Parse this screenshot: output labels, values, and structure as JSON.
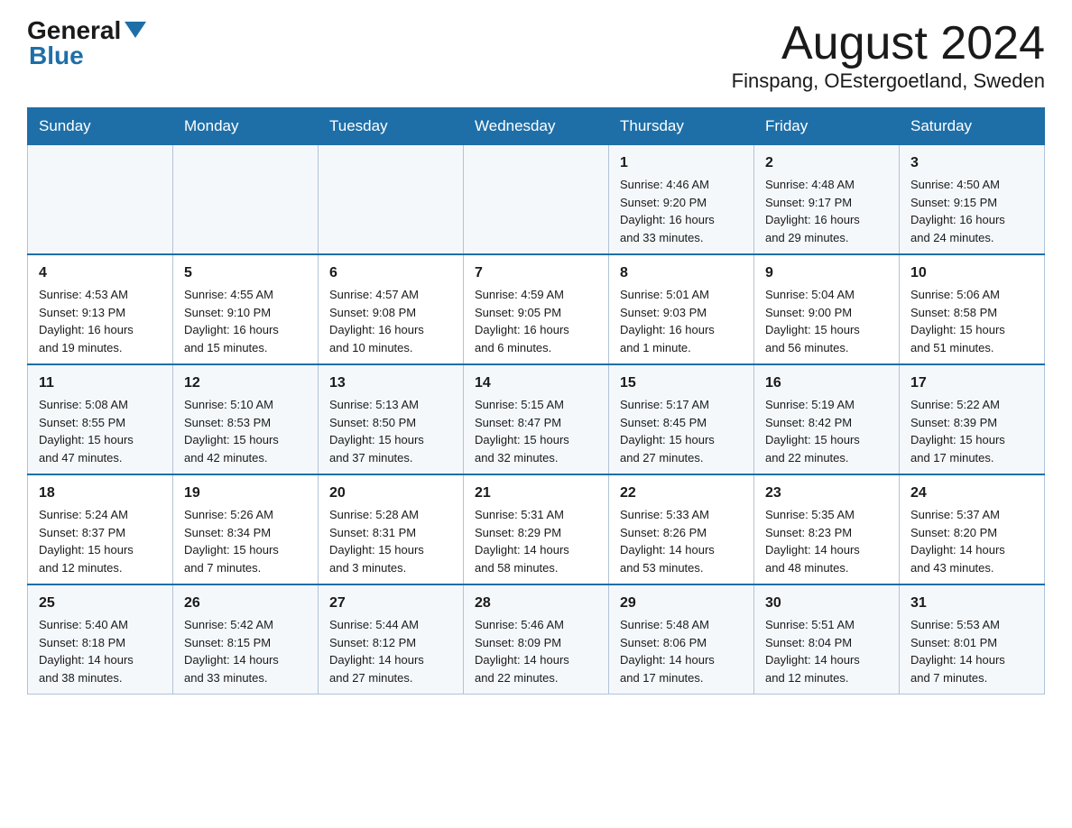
{
  "logo": {
    "general": "General",
    "blue": "Blue"
  },
  "header": {
    "month": "August 2024",
    "location": "Finspang, OEstergoetland, Sweden"
  },
  "weekdays": [
    "Sunday",
    "Monday",
    "Tuesday",
    "Wednesday",
    "Thursday",
    "Friday",
    "Saturday"
  ],
  "weeks": [
    [
      {
        "day": "",
        "info": ""
      },
      {
        "day": "",
        "info": ""
      },
      {
        "day": "",
        "info": ""
      },
      {
        "day": "",
        "info": ""
      },
      {
        "day": "1",
        "info": "Sunrise: 4:46 AM\nSunset: 9:20 PM\nDaylight: 16 hours\nand 33 minutes."
      },
      {
        "day": "2",
        "info": "Sunrise: 4:48 AM\nSunset: 9:17 PM\nDaylight: 16 hours\nand 29 minutes."
      },
      {
        "day": "3",
        "info": "Sunrise: 4:50 AM\nSunset: 9:15 PM\nDaylight: 16 hours\nand 24 minutes."
      }
    ],
    [
      {
        "day": "4",
        "info": "Sunrise: 4:53 AM\nSunset: 9:13 PM\nDaylight: 16 hours\nand 19 minutes."
      },
      {
        "day": "5",
        "info": "Sunrise: 4:55 AM\nSunset: 9:10 PM\nDaylight: 16 hours\nand 15 minutes."
      },
      {
        "day": "6",
        "info": "Sunrise: 4:57 AM\nSunset: 9:08 PM\nDaylight: 16 hours\nand 10 minutes."
      },
      {
        "day": "7",
        "info": "Sunrise: 4:59 AM\nSunset: 9:05 PM\nDaylight: 16 hours\nand 6 minutes."
      },
      {
        "day": "8",
        "info": "Sunrise: 5:01 AM\nSunset: 9:03 PM\nDaylight: 16 hours\nand 1 minute."
      },
      {
        "day": "9",
        "info": "Sunrise: 5:04 AM\nSunset: 9:00 PM\nDaylight: 15 hours\nand 56 minutes."
      },
      {
        "day": "10",
        "info": "Sunrise: 5:06 AM\nSunset: 8:58 PM\nDaylight: 15 hours\nand 51 minutes."
      }
    ],
    [
      {
        "day": "11",
        "info": "Sunrise: 5:08 AM\nSunset: 8:55 PM\nDaylight: 15 hours\nand 47 minutes."
      },
      {
        "day": "12",
        "info": "Sunrise: 5:10 AM\nSunset: 8:53 PM\nDaylight: 15 hours\nand 42 minutes."
      },
      {
        "day": "13",
        "info": "Sunrise: 5:13 AM\nSunset: 8:50 PM\nDaylight: 15 hours\nand 37 minutes."
      },
      {
        "day": "14",
        "info": "Sunrise: 5:15 AM\nSunset: 8:47 PM\nDaylight: 15 hours\nand 32 minutes."
      },
      {
        "day": "15",
        "info": "Sunrise: 5:17 AM\nSunset: 8:45 PM\nDaylight: 15 hours\nand 27 minutes."
      },
      {
        "day": "16",
        "info": "Sunrise: 5:19 AM\nSunset: 8:42 PM\nDaylight: 15 hours\nand 22 minutes."
      },
      {
        "day": "17",
        "info": "Sunrise: 5:22 AM\nSunset: 8:39 PM\nDaylight: 15 hours\nand 17 minutes."
      }
    ],
    [
      {
        "day": "18",
        "info": "Sunrise: 5:24 AM\nSunset: 8:37 PM\nDaylight: 15 hours\nand 12 minutes."
      },
      {
        "day": "19",
        "info": "Sunrise: 5:26 AM\nSunset: 8:34 PM\nDaylight: 15 hours\nand 7 minutes."
      },
      {
        "day": "20",
        "info": "Sunrise: 5:28 AM\nSunset: 8:31 PM\nDaylight: 15 hours\nand 3 minutes."
      },
      {
        "day": "21",
        "info": "Sunrise: 5:31 AM\nSunset: 8:29 PM\nDaylight: 14 hours\nand 58 minutes."
      },
      {
        "day": "22",
        "info": "Sunrise: 5:33 AM\nSunset: 8:26 PM\nDaylight: 14 hours\nand 53 minutes."
      },
      {
        "day": "23",
        "info": "Sunrise: 5:35 AM\nSunset: 8:23 PM\nDaylight: 14 hours\nand 48 minutes."
      },
      {
        "day": "24",
        "info": "Sunrise: 5:37 AM\nSunset: 8:20 PM\nDaylight: 14 hours\nand 43 minutes."
      }
    ],
    [
      {
        "day": "25",
        "info": "Sunrise: 5:40 AM\nSunset: 8:18 PM\nDaylight: 14 hours\nand 38 minutes."
      },
      {
        "day": "26",
        "info": "Sunrise: 5:42 AM\nSunset: 8:15 PM\nDaylight: 14 hours\nand 33 minutes."
      },
      {
        "day": "27",
        "info": "Sunrise: 5:44 AM\nSunset: 8:12 PM\nDaylight: 14 hours\nand 27 minutes."
      },
      {
        "day": "28",
        "info": "Sunrise: 5:46 AM\nSunset: 8:09 PM\nDaylight: 14 hours\nand 22 minutes."
      },
      {
        "day": "29",
        "info": "Sunrise: 5:48 AM\nSunset: 8:06 PM\nDaylight: 14 hours\nand 17 minutes."
      },
      {
        "day": "30",
        "info": "Sunrise: 5:51 AM\nSunset: 8:04 PM\nDaylight: 14 hours\nand 12 minutes."
      },
      {
        "day": "31",
        "info": "Sunrise: 5:53 AM\nSunset: 8:01 PM\nDaylight: 14 hours\nand 7 minutes."
      }
    ]
  ]
}
